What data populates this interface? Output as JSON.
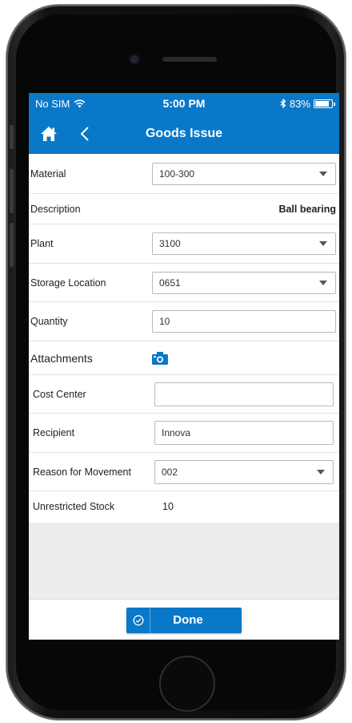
{
  "status_bar": {
    "carrier": "No SIM",
    "time": "5:00 PM",
    "battery": "83%",
    "battery_level": 0.83
  },
  "nav": {
    "title": "Goods Issue",
    "home_icon": "home-icon",
    "back_icon": "chevron-left-icon"
  },
  "form": {
    "material": {
      "label": "Material",
      "value": "100-300"
    },
    "description": {
      "label": "Description",
      "value": "Ball bearing"
    },
    "plant": {
      "label": "Plant",
      "value": "3100"
    },
    "storage_location": {
      "label": "Storage Location",
      "value": "0651"
    },
    "quantity": {
      "label": "Quantity",
      "value": "10"
    },
    "attachments": {
      "label": "Attachments",
      "icon": "camera-icon"
    },
    "cost_center": {
      "label": "Cost Center",
      "value": ""
    },
    "recipient": {
      "label": "Recipient",
      "value": "Innova"
    },
    "reason": {
      "label": "Reason for Movement",
      "value": "002"
    },
    "unrestricted_stock": {
      "label": "Unrestricted Stock",
      "value": "10"
    }
  },
  "footer": {
    "done_label": "Done",
    "done_icon": "check-circle-icon"
  },
  "colors": {
    "primary": "#0a78c8",
    "background": "#ffffff",
    "empty_area": "#ededed"
  }
}
